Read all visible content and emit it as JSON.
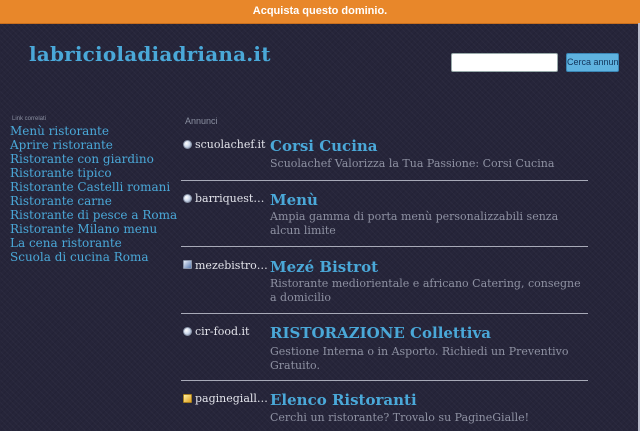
{
  "top_banner": {
    "label": "Acquista questo dominio."
  },
  "site": {
    "title": "labricioladiadriana.it"
  },
  "search": {
    "placeholder": "",
    "value": "",
    "button_label": "Cerca annunci"
  },
  "sidebar": {
    "heading": "Link correlati",
    "links": [
      "Menù ristorante",
      "Aprire ristorante",
      "Ristorante con giardino",
      "Ristorante tipico",
      "Ristorante Castelli romani",
      "Ristorante carne",
      "Ristorante di pesce a Roma",
      "Ristorante Milano menu",
      "La cena ristorante",
      "Scuola di cucina Roma"
    ]
  },
  "ads": {
    "heading": "Annunci",
    "items": [
      {
        "domain": "scuolachef.it",
        "title": "Corsi Cucina",
        "description": "Scuolachef Valorizza la Tua Passione: Corsi Cucina"
      },
      {
        "domain": "barriquest…",
        "title": "Menù",
        "description": "Ampia gamma di porta menù personalizzabili senza alcun limite"
      },
      {
        "domain": "mezebistro…",
        "title": "Mezé Bistrot",
        "description": "Ristorante mediorientale e africano Catering, consegne a domicilio"
      },
      {
        "domain": "cir-food.it",
        "title": "RISTORAZIONE Collettiva",
        "description": "Gestione Interna o in Asporto. Richiedi un Preventivo Gratuito."
      },
      {
        "domain": "paginegiall…",
        "title": "Elenco Ristoranti",
        "description": "Cerchi un ristorante? Trovalo su PagineGialle!"
      }
    ]
  }
}
